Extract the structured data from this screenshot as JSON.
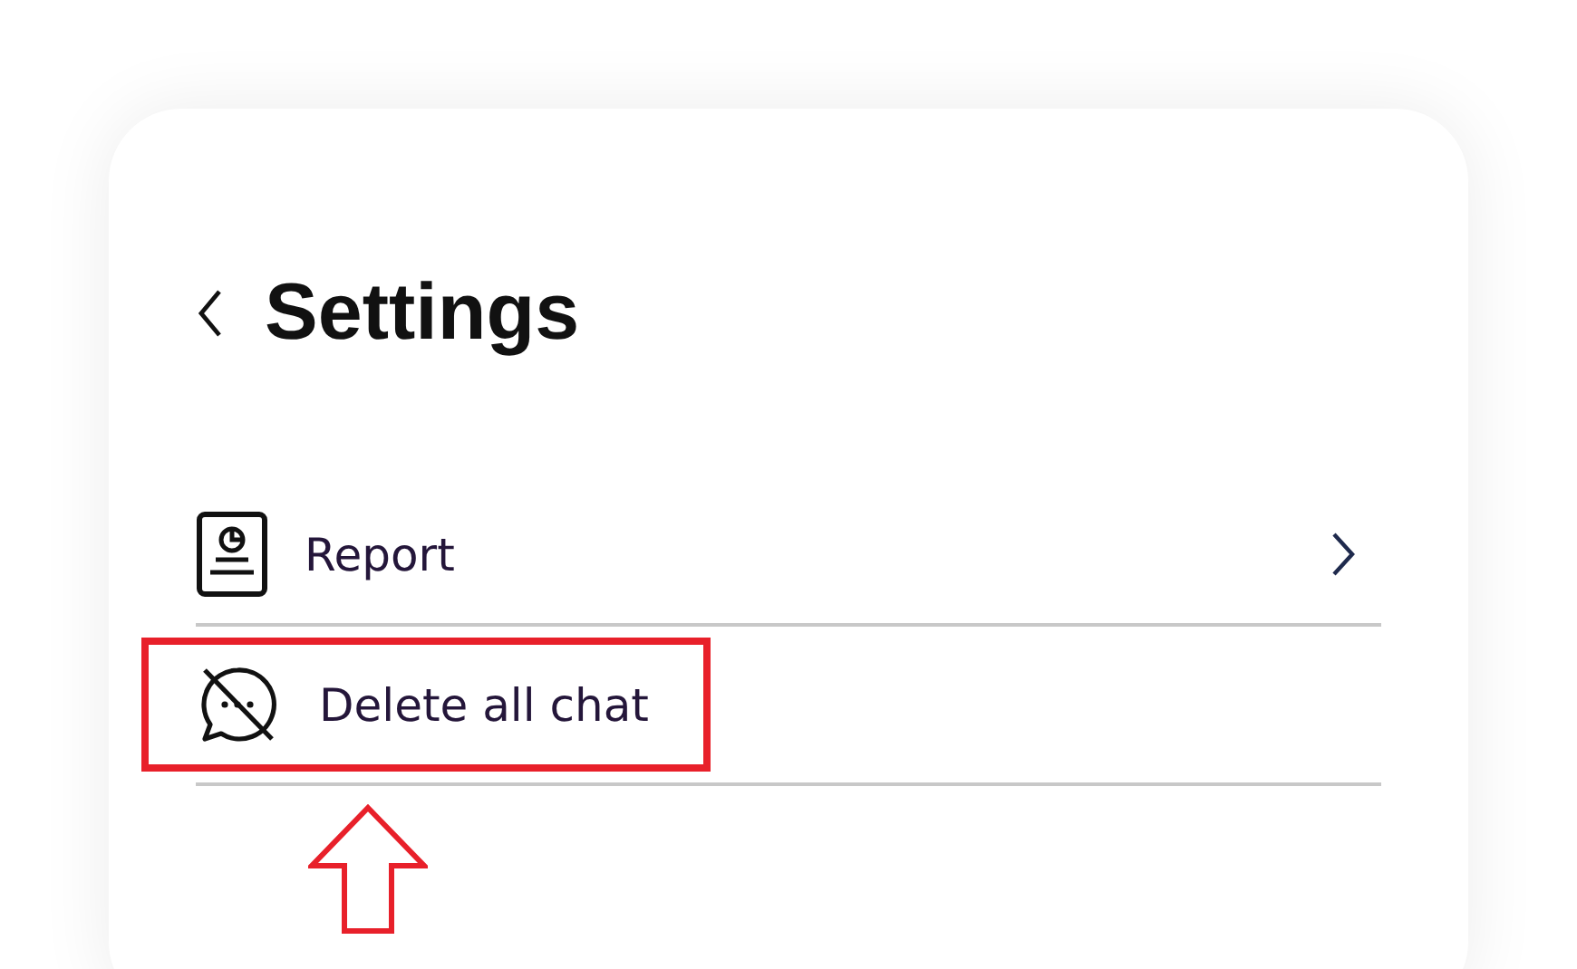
{
  "header": {
    "title": "Settings"
  },
  "items": [
    {
      "kind": "report",
      "label": "Report",
      "chevron": true,
      "highlighted": false
    },
    {
      "kind": "delete-chat",
      "label": "Delete all chat",
      "chevron": false,
      "highlighted": true
    }
  ]
}
